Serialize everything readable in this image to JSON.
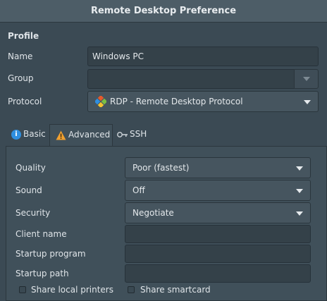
{
  "window": {
    "title": "Remote Desktop Preference"
  },
  "profile": {
    "section_title": "Profile",
    "name_label": "Name",
    "name_value": "Windows PC",
    "group_label": "Group",
    "group_value": "",
    "protocol_label": "Protocol",
    "protocol_value": "RDP - Remote Desktop Protocol"
  },
  "tabs": [
    {
      "label": "Basic",
      "icon": "info-icon"
    },
    {
      "label": "Advanced",
      "icon": "warning-icon"
    },
    {
      "label": "SSH",
      "icon": "key-icon"
    }
  ],
  "advanced": {
    "quality_label": "Quality",
    "quality_value": "Poor (fastest)",
    "sound_label": "Sound",
    "sound_value": "Off",
    "security_label": "Security",
    "security_value": "Negotiate",
    "client_name_label": "Client name",
    "client_name_value": "",
    "startup_program_label": "Startup program",
    "startup_program_value": "",
    "startup_path_label": "Startup path",
    "startup_path_value": "",
    "share_printers_label": "Share local printers",
    "share_printers_checked": false,
    "share_smartcard_label": "Share smartcard",
    "share_smartcard_checked": false
  },
  "colors": {
    "background": "#3b4a54",
    "panel": "#40505a",
    "info_blue": "#2f8fe0",
    "warning_orange": "#f0a030"
  }
}
